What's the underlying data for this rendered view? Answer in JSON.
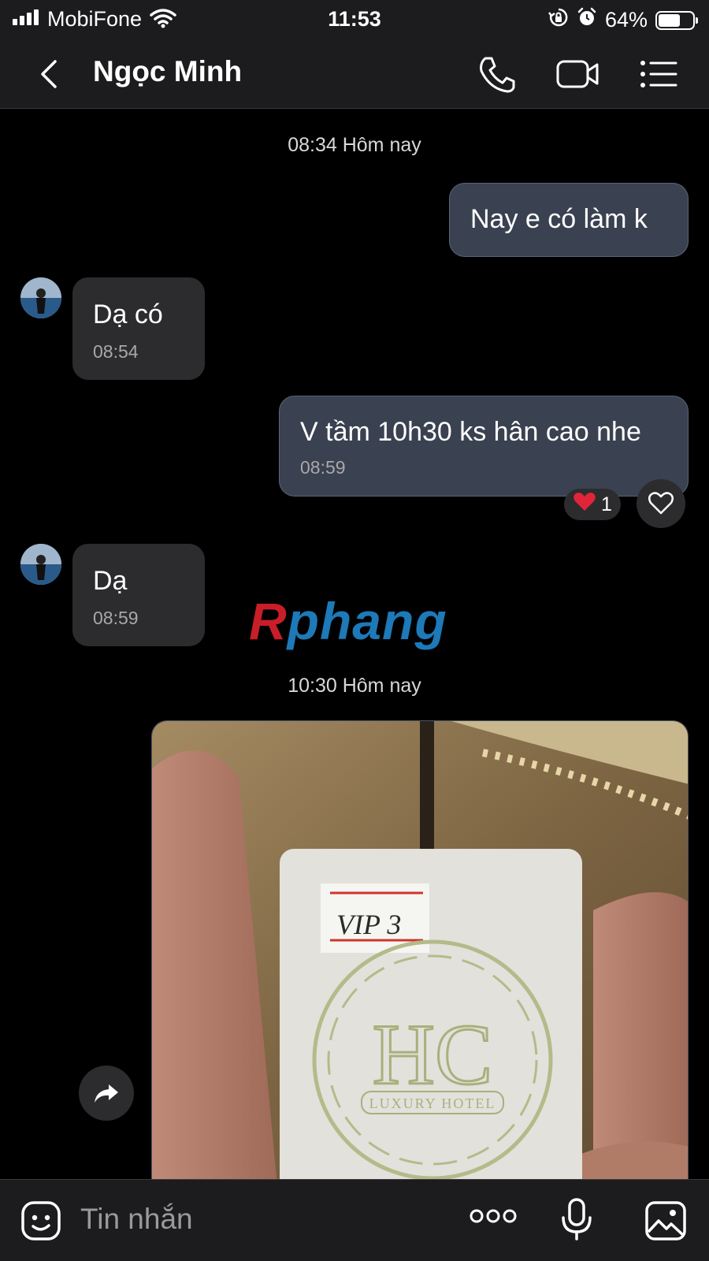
{
  "status_bar": {
    "carrier": "MobiFone",
    "time": "11:53",
    "battery_percent": "64%",
    "battery_level": 0.64,
    "icons": [
      "signal-icon",
      "wifi-icon",
      "orientation-lock-icon",
      "alarm-icon",
      "battery-icon"
    ]
  },
  "header": {
    "contact_name": "Ngọc Minh",
    "icons": [
      "back-icon",
      "phone-icon",
      "video-call-icon",
      "menu-icon"
    ]
  },
  "messages": [
    {
      "type": "time_separator",
      "text": "08:34 Hôm nay"
    },
    {
      "type": "outgoing",
      "text": "Nay e có làm k"
    },
    {
      "type": "incoming",
      "text": "Dạ có",
      "time": "08:54"
    },
    {
      "type": "outgoing",
      "text": "V tầm 10h30 ks hân cao nhe",
      "time": "08:59",
      "reaction": {
        "emoji": "❤️",
        "count": "1"
      }
    },
    {
      "type": "incoming",
      "text": "Dạ",
      "time": "08:59"
    },
    {
      "type": "time_separator",
      "text": "10:30 Hôm nay"
    },
    {
      "type": "outgoing_image",
      "label_text": "VIP 3",
      "logo_text": "HC",
      "logo_subtext": "LUXURY HOTEL"
    }
  ],
  "watermark": {
    "part_a": "R",
    "part_b": "phang"
  },
  "input_bar": {
    "placeholder": "Tin nhắn",
    "icons": [
      "sticker-icon",
      "more-icon",
      "microphone-icon",
      "gallery-icon"
    ]
  },
  "colors": {
    "bar_bg": "#1c1c1e",
    "outgoing_bubble": "#3a4150",
    "incoming_bubble": "#2c2c2e",
    "watermark_red": "#c81e28",
    "watermark_blue": "#1d79b8"
  }
}
